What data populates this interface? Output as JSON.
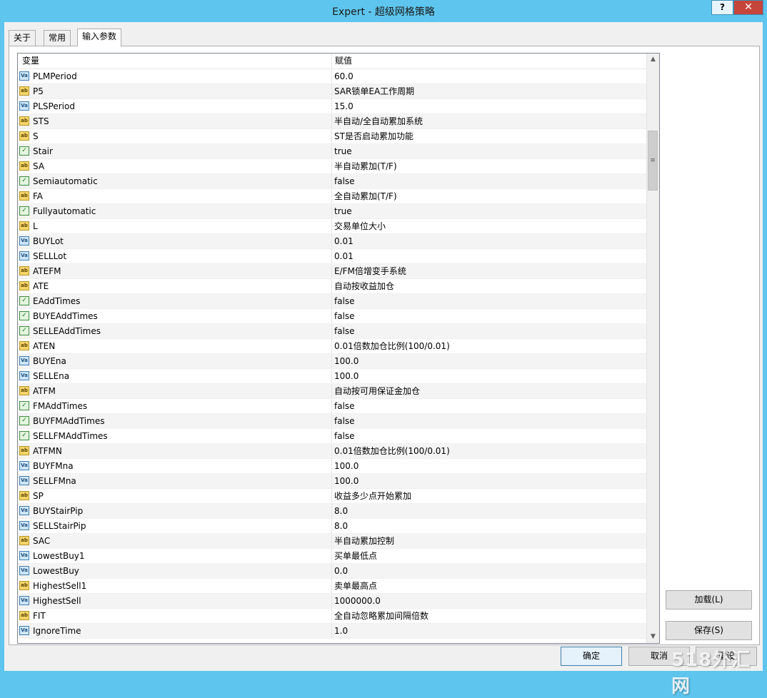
{
  "window": {
    "title": "Expert - 超级网格策略",
    "help_label": "?",
    "close_label": "✕"
  },
  "tabs": [
    {
      "label": "关于"
    },
    {
      "label": "常用"
    },
    {
      "label": "输入参数"
    }
  ],
  "grid": {
    "col_variable": "变量",
    "col_value": "赋值",
    "rows": [
      {
        "type": "num",
        "name": "PLMPeriod",
        "value": "60.0"
      },
      {
        "type": "ab",
        "name": "P5",
        "value": "SAR锁单EA工作周期"
      },
      {
        "type": "num",
        "name": "PLSPeriod",
        "value": "15.0"
      },
      {
        "type": "ab",
        "name": "STS",
        "value": "半自动/全自动累加系统"
      },
      {
        "type": "ab",
        "name": "S",
        "value": "ST是否启动累加功能"
      },
      {
        "type": "bool",
        "name": "Stair",
        "value": "true"
      },
      {
        "type": "ab",
        "name": "SA",
        "value": "半自动累加(T/F)"
      },
      {
        "type": "bool",
        "name": "Semiautomatic",
        "value": "false"
      },
      {
        "type": "ab",
        "name": "FA",
        "value": "全自动累加(T/F)"
      },
      {
        "type": "bool",
        "name": "Fullyautomatic",
        "value": "true"
      },
      {
        "type": "ab",
        "name": "L",
        "value": "交易单位大小"
      },
      {
        "type": "num",
        "name": "BUYLot",
        "value": "0.01"
      },
      {
        "type": "num",
        "name": "SELLLot",
        "value": "0.01"
      },
      {
        "type": "ab",
        "name": "ATEFM",
        "value": "E/FM倍增变手系统"
      },
      {
        "type": "ab",
        "name": "ATE",
        "value": "自动按收益加仓"
      },
      {
        "type": "bool",
        "name": "EAddTimes",
        "value": "false"
      },
      {
        "type": "bool",
        "name": "BUYEAddTimes",
        "value": "false"
      },
      {
        "type": "bool",
        "name": "SELLEAddTimes",
        "value": "false"
      },
      {
        "type": "ab",
        "name": "ATEN",
        "value": "0.01倍数加仓比例(100/0.01)"
      },
      {
        "type": "num",
        "name": "BUYEna",
        "value": "100.0"
      },
      {
        "type": "num",
        "name": "SELLEna",
        "value": "100.0"
      },
      {
        "type": "ab",
        "name": "ATFM",
        "value": "自动按可用保证金加仓"
      },
      {
        "type": "bool",
        "name": "FMAddTimes",
        "value": "false"
      },
      {
        "type": "bool",
        "name": "BUYFMAddTimes",
        "value": "false"
      },
      {
        "type": "bool",
        "name": "SELLFMAddTimes",
        "value": "false"
      },
      {
        "type": "ab",
        "name": "ATFMN",
        "value": "0.01倍数加仓比例(100/0.01)"
      },
      {
        "type": "num",
        "name": "BUYFMna",
        "value": "100.0"
      },
      {
        "type": "num",
        "name": "SELLFMna",
        "value": "100.0"
      },
      {
        "type": "ab",
        "name": "SP",
        "value": "收益多少点开始累加"
      },
      {
        "type": "num",
        "name": "BUYStairPip",
        "value": "8.0"
      },
      {
        "type": "num",
        "name": "SELLStairPip",
        "value": "8.0"
      },
      {
        "type": "ab",
        "name": "SAC",
        "value": "半自动累加控制"
      },
      {
        "type": "num",
        "name": "LowestBuy1",
        "value": "买单最低点"
      },
      {
        "type": "num",
        "name": "LowestBuy",
        "value": "0.0"
      },
      {
        "type": "ab",
        "name": "HighestSell1",
        "value": "卖单最高点"
      },
      {
        "type": "num",
        "name": "HighestSell",
        "value": "1000000.0"
      },
      {
        "type": "ab",
        "name": "FIT",
        "value": "全自动忽略累加间隔倍数"
      },
      {
        "type": "num",
        "name": "IgnoreTime",
        "value": "1.0"
      }
    ]
  },
  "icons": {
    "ab": "ab",
    "num": "Va",
    "bool": "✓"
  },
  "buttons": {
    "load": "加载(L)",
    "save": "保存(S)",
    "ok": "确定",
    "cancel": "取消",
    "reset": "重设"
  },
  "watermark": "518外汇网"
}
